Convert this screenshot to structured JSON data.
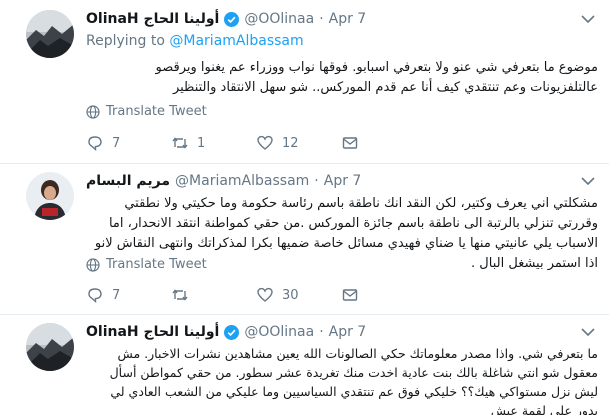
{
  "tweets": [
    {
      "name": "OlinaH أولينا الحاج",
      "handle": "@OOlinaa",
      "dot": "·",
      "time": "Apr 7",
      "replying_prefix": "Replying to",
      "replying_to": "@MariamAlbassam",
      "body": "موضوع ما بتعرفي شي عنو ولا بتعرفي اسبابو. فوقها نواب ووزراء عم يغنوا ويرقصو عالتلفزيونات وعم تنتقدي كيف أنا عم قدم الموركس.. شو سهل الانتقاد والتنظير",
      "translate": "Translate Tweet",
      "replies": "7",
      "retweets": "1",
      "likes": "12"
    },
    {
      "name": "مريم البسام",
      "handle": "@MariamAlbassam",
      "dot": "·",
      "time": "Apr 7",
      "body": "مشكلتي اني يعرف وكتير، لكن النقد انك ناطقة باسم رئاسة حكومة وما حكيتي ولا نطقتي وقررتي تنزلي بالرتبة الى ناطقة باسم جائزة الموركس .من حقي كمواطنة انتقد الانحدار، اما الاسباب يلي عانيتي منها يا ضناي فهيدي مسائل خاصة ضميها بكرا لمذكراتك وانتهى النقاش لانو اذا استمر  بيشغل البال .",
      "translate": "Translate Tweet",
      "replies": "7",
      "retweets": "",
      "likes": "30"
    },
    {
      "name": "OlinaH أولينا الحاج",
      "handle": "@OOlinaa",
      "dot": "·",
      "time": "Apr 7",
      "body": "ما بتعرفي شي. واذا مصدر معلوماتك حكي الصالونات الله يعين مشاهدين نشرات الاخبار. مش معقول شو انتي شاغلة بالك بنت عادية اخدت منك تغريدة عشر سطور. من حقي كمواطن أسأل ليش نزل مستواكي هيك؟؟ خليكي فوق عم تنتقدي السياسيين وما عليكي من الشعب العادي لي بدور على لقمة عيش"
    }
  ],
  "colors": {
    "link": "#1da1f2",
    "muted": "#657786",
    "divider": "#e6ecf0"
  }
}
